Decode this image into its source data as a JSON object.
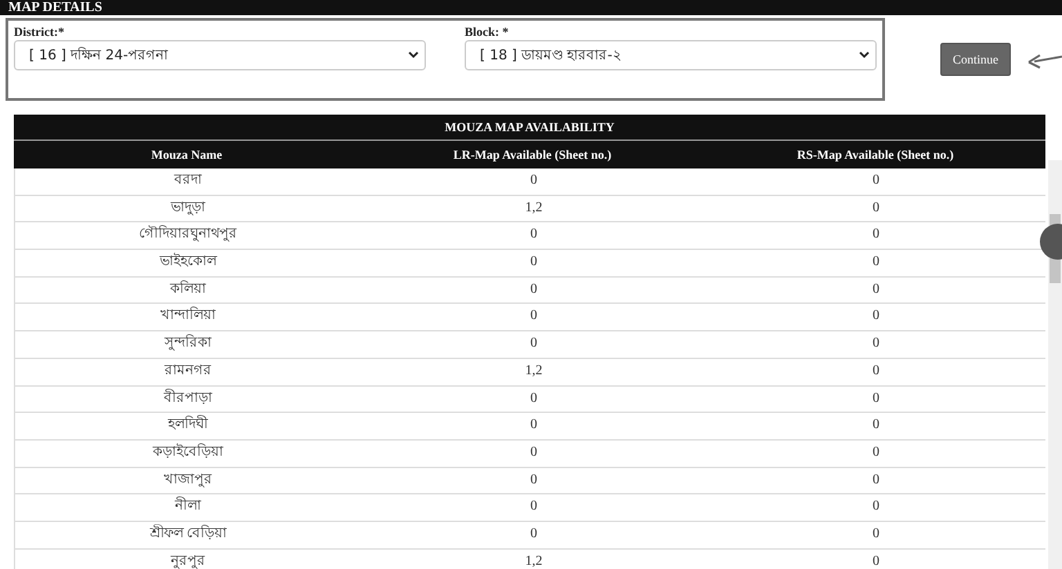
{
  "header": {
    "title": "MAP DETAILS"
  },
  "form": {
    "fields": [
      {
        "label": "District:*",
        "value": "[ 16 ] দক্ষিন 24-পরগনা"
      },
      {
        "label": "Block: *",
        "value": "[ 18 ] ডায়মণ্ড হারবার-২"
      }
    ],
    "button": "Continue"
  },
  "table": {
    "title": "MOUZA MAP AVAILABILITY",
    "columns": [
      "Mouza Name",
      "LR-Map Available (Sheet no.)",
      "RS-Map Available (Sheet no.)"
    ],
    "rows": [
      [
        "বরদা",
        "0",
        "0"
      ],
      [
        "ভাদুড়া",
        "1,2",
        "0"
      ],
      [
        "গৌদিয়ারঘুনাথপুর",
        "0",
        "0"
      ],
      [
        "ভাইহকোল",
        "0",
        "0"
      ],
      [
        "কলিয়া",
        "0",
        "0"
      ],
      [
        "খান্দালিয়া",
        "0",
        "0"
      ],
      [
        "সুন্দরিকা",
        "0",
        "0"
      ],
      [
        "রামনগর",
        "1,2",
        "0"
      ],
      [
        "বীরপাড়া",
        "0",
        "0"
      ],
      [
        "হলদিঘী",
        "0",
        "0"
      ],
      [
        "কড়াইবেড়িয়া",
        "0",
        "0"
      ],
      [
        "খাজাপুর",
        "0",
        "0"
      ],
      [
        "নীলা",
        "0",
        "0"
      ],
      [
        "শ্রীফল বেড়িয়া",
        "0",
        "0"
      ],
      [
        "নুরপুর",
        "1,2",
        "0"
      ]
    ]
  }
}
